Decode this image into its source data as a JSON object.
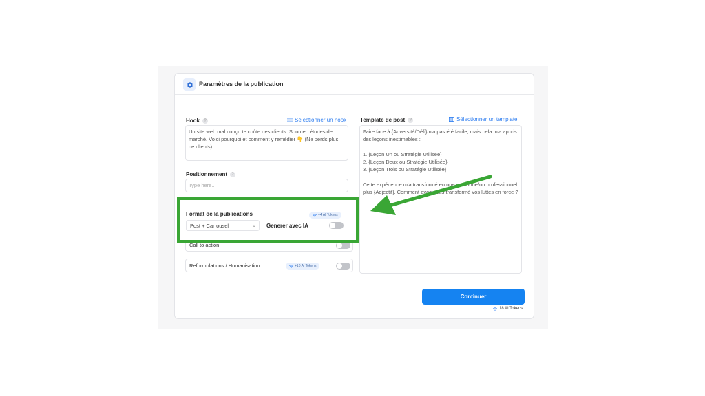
{
  "panel": {
    "title": "Paramètres de la publication",
    "icon": "gear-icon"
  },
  "hook": {
    "label": "Hook",
    "help": "?",
    "select_link": "Sélectionner un hook",
    "value": "Un site web mal conçu te coûte des clients. Source : études de marché. Voici pourquoi et comment y remédier 👇 (Ne perds plus de clients)"
  },
  "positionnement": {
    "label": "Positionnement",
    "help": "?",
    "placeholder": "Type here..."
  },
  "format": {
    "label": "Format de la publications",
    "selected": "Post + Carrousel",
    "generate_label": "Generer avec IA",
    "token_badge": "+4 AI Tokens",
    "toggle_on": false
  },
  "call_to_action": {
    "label": "Call to action",
    "toggle_on": false
  },
  "reformulations": {
    "label": "Reformulations / Humanisation",
    "token_badge": "+10 AI Tokens",
    "toggle_on": false
  },
  "template": {
    "label": "Template de post",
    "help": "?",
    "select_link": "Sélectionner un template",
    "value": "Faire face à {Adversité/Défi} n'a pas été facile, mais cela m'a appris des leçons inestimables :\n\n1. {Leçon Un ou Stratégie Utilisée}\n2. {Leçon Deux ou Stratégie Utilisée}\n3. {Leçon Trois ou Stratégie Utilisée}\n\nCette expérience m'a transformé en une personne/un professionnel plus {Adjectif}. Comment avez-vous transformé vos luttes en force ?"
  },
  "actions": {
    "continue_label": "Continuer",
    "tokens_total": "18 AI Tokens"
  },
  "colors": {
    "accent": "#1583f1",
    "highlight": "#3aa635"
  }
}
